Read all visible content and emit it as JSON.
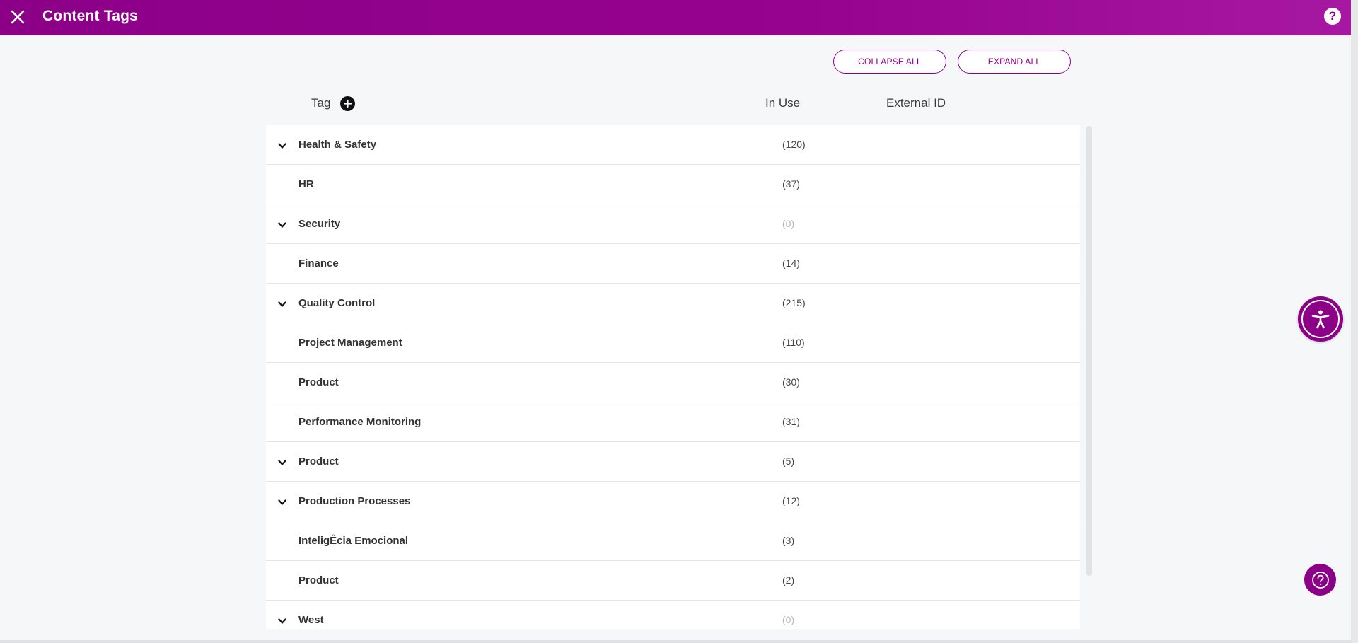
{
  "header": {
    "title": "Content Tags",
    "close_icon": "close-icon",
    "help_label": "?"
  },
  "toolbar": {
    "collapse_all_label": "COLLAPSE ALL",
    "expand_all_label": "EXPAND ALL"
  },
  "columns": {
    "tag": "Tag",
    "in_use": "In Use",
    "external_id": "External ID"
  },
  "tags": [
    {
      "name": "Health & Safety",
      "count": "(120)",
      "expandable": true,
      "zero": false
    },
    {
      "name": "HR",
      "count": "(37)",
      "expandable": false,
      "zero": false
    },
    {
      "name": "Security",
      "count": "(0)",
      "expandable": true,
      "zero": true
    },
    {
      "name": "Finance",
      "count": "(14)",
      "expandable": false,
      "zero": false
    },
    {
      "name": "Quality Control",
      "count": "(215)",
      "expandable": true,
      "zero": false
    },
    {
      "name": "Project Management",
      "count": "(110)",
      "expandable": false,
      "zero": false
    },
    {
      "name": "Product",
      "count": "(30)",
      "expandable": false,
      "zero": false
    },
    {
      "name": "Performance Monitoring",
      "count": "(31)",
      "expandable": false,
      "zero": false
    },
    {
      "name": "Product",
      "count": "(5)",
      "expandable": true,
      "zero": false
    },
    {
      "name": "Production Processes",
      "count": "(12)",
      "expandable": true,
      "zero": false
    },
    {
      "name": "InteligÊcia Emocional",
      "count": "(3)",
      "expandable": false,
      "zero": false
    },
    {
      "name": "Product",
      "count": "(2)",
      "expandable": false,
      "zero": false
    },
    {
      "name": "West",
      "count": "(0)",
      "expandable": true,
      "zero": true
    }
  ],
  "colors": {
    "brand": "#8c0088",
    "header_gradient_end": "#a718a2",
    "muted_count": "#b5b5b5"
  },
  "icons": {
    "add_tag": "plus-circle-icon",
    "expand_row": "chevron-down-icon",
    "accessibility": "accessibility-icon",
    "support": "question-circle-icon"
  }
}
